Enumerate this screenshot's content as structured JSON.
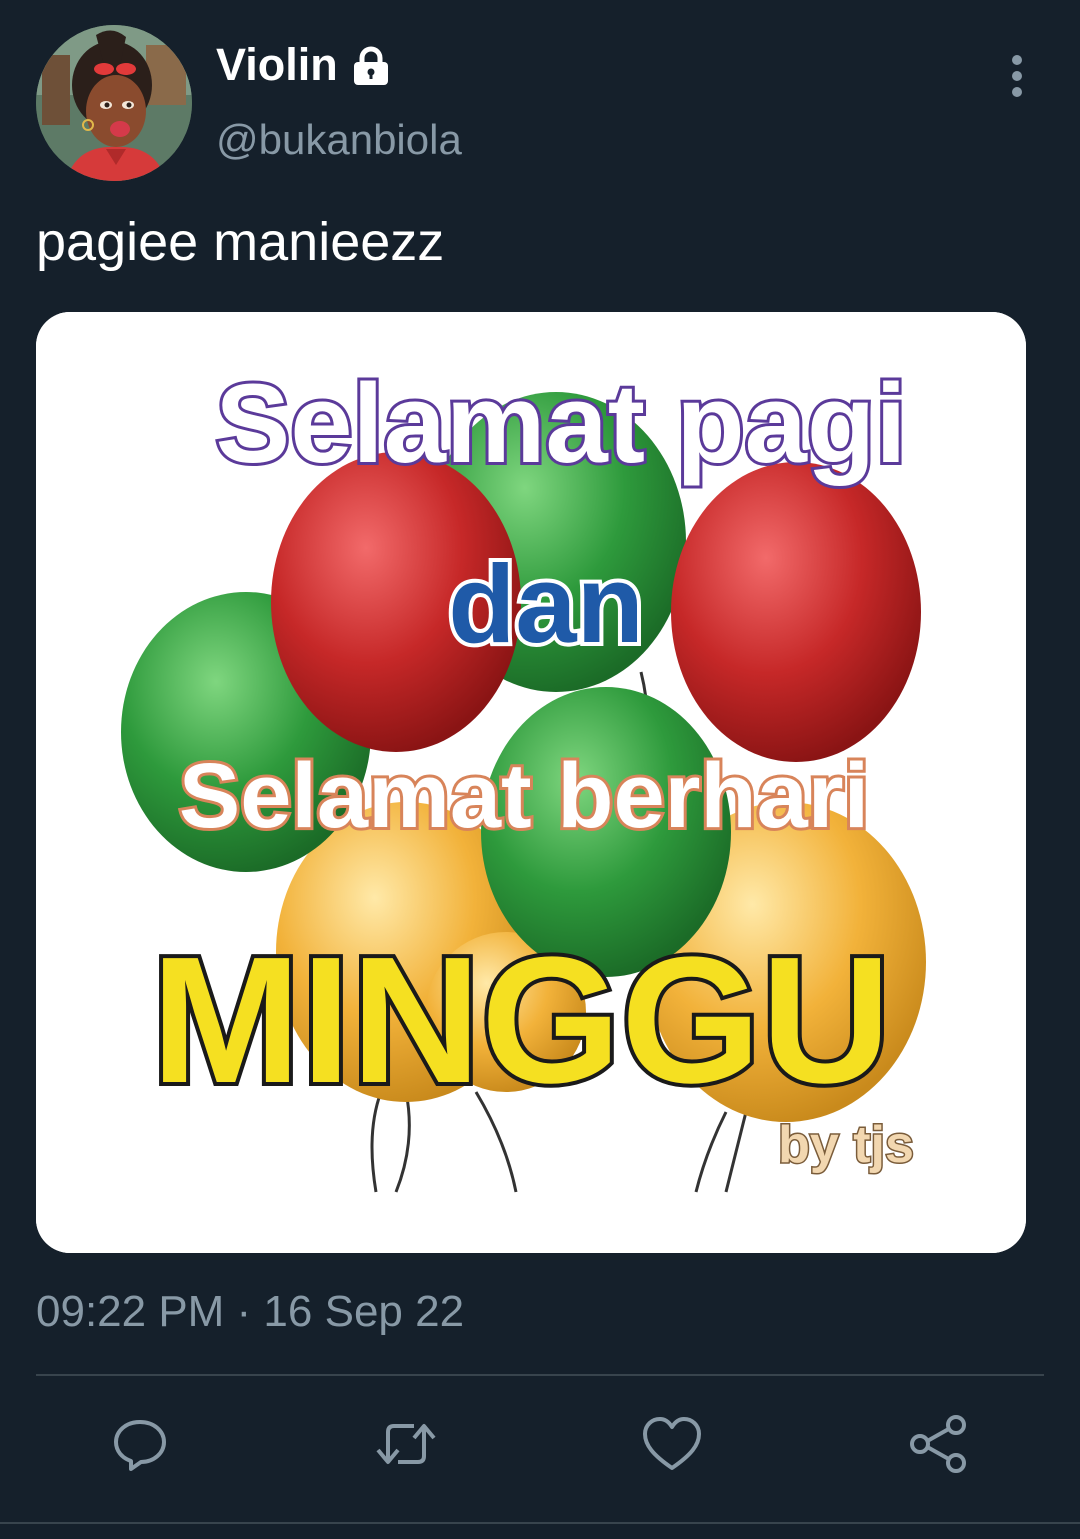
{
  "tweet": {
    "display_name": "Violin",
    "handle": "@bukanbiola",
    "text": "pagiee manieezz",
    "timestamp": "09:22 PM · 16 Sep 22",
    "protected_icon": "lock-icon",
    "menu_icon": "more-vertical-icon"
  },
  "media": {
    "line1": "Selamat pagi",
    "line2": "dan",
    "line3": "Selamat berhari",
    "line4": "MINGGU",
    "signature": "by tjs"
  },
  "actions": [
    {
      "name": "reply",
      "icon": "reply-icon"
    },
    {
      "name": "retweet",
      "icon": "retweet-icon"
    },
    {
      "name": "like",
      "icon": "heart-icon"
    },
    {
      "name": "share",
      "icon": "share-icon"
    }
  ],
  "colors": {
    "background": "#15202b",
    "secondary_text": "#8899a6",
    "divider": "#38444d",
    "balloon_red": "#c62828",
    "balloon_green": "#2e9a3c",
    "balloon_yellow": "#f2b23a"
  }
}
